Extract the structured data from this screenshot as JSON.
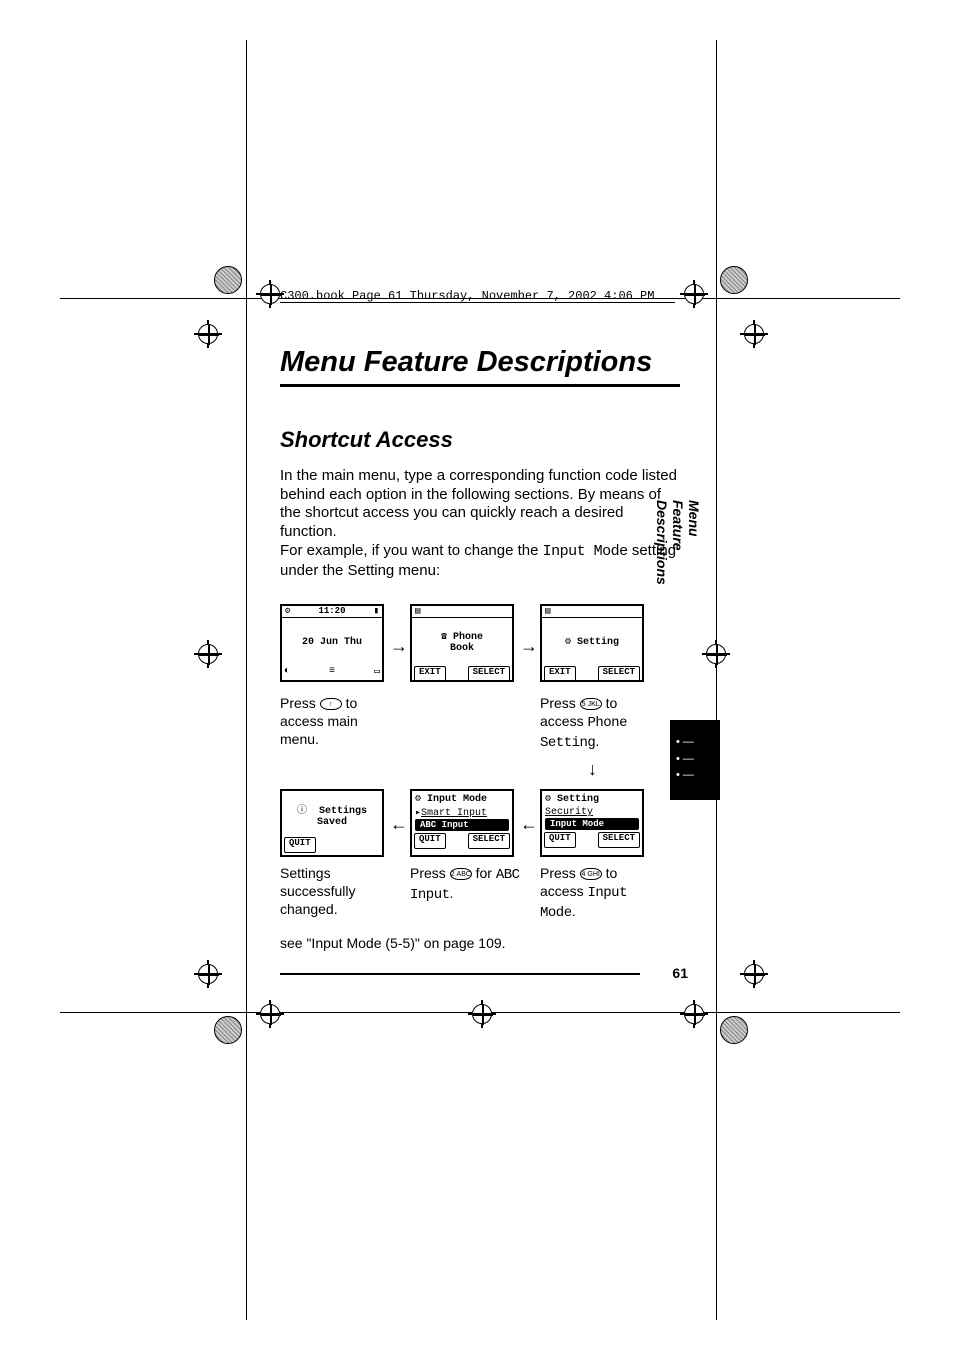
{
  "header_line": "C300.book  Page 61  Thursday, November 7, 2002  4:06 PM",
  "title": "Menu Feature Descriptions",
  "section": "Shortcut Access",
  "para1": "In the main menu, type a corresponding function code  listed behind each option in the following sections. By  means of the shortcut access you can quickly reach a  desired function.",
  "para2a": "For example, if you want to change the ",
  "para2_label": "Input Mode",
  "para2b": "  setting under the Setting menu:",
  "side_tab": "Menu Feature Descriptions",
  "page_number": "61",
  "screens": {
    "s1_time": "11:20",
    "s1_date": "20 Jun Thu",
    "s2_title1": "Phone",
    "s2_title2": "Book",
    "s3_title": "Setting",
    "s4_title": "Setting",
    "s4_line1": "Security",
    "s4_line2": "Input Mode",
    "s5_title": "Input Mode",
    "s5_line1": "Smart Input",
    "s5_line2": "ABC Input",
    "s6_title": "Settings",
    "s6_line2": "Saved",
    "exit": "EXIT",
    "select": "SELECT",
    "quit": "QUIT"
  },
  "captions": {
    "c1a": "Press ",
    "c1b": "  to access main menu.",
    "c2a": "Press ",
    "c2b": "  to access ",
    "c2label": "Phone Setting",
    "c2c": ".",
    "c3a": "Press ",
    "c3b": "  to access ",
    "c3label": "Input Mode",
    "c3c": ".",
    "c4a": "Press ",
    "c4b": "  for ",
    "c4label": "ABC Input",
    "c4c": ".",
    "c5": "Settings successfully changed."
  },
  "see_also": "see \"Input Mode (5-5)\" on page 109."
}
